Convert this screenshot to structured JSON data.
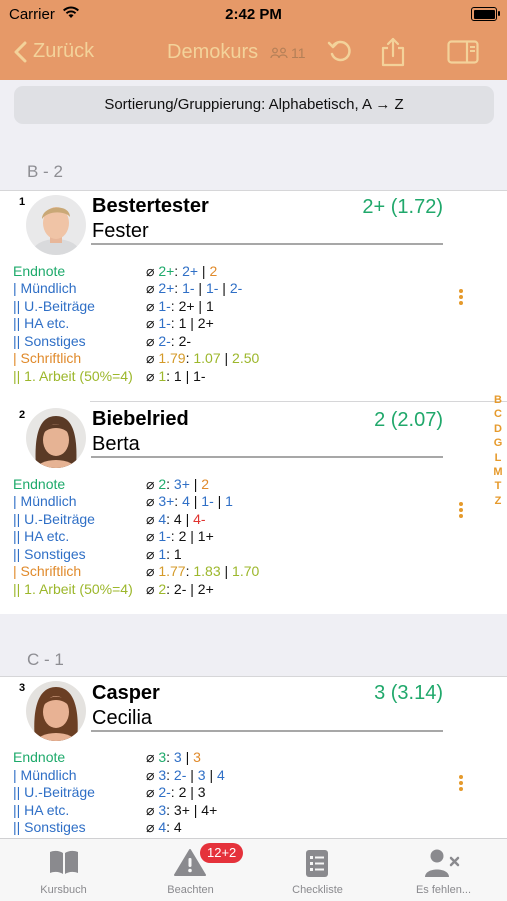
{
  "status": {
    "carrier": "Carrier",
    "time": "2:42 PM"
  },
  "nav": {
    "back_label": "Zurück",
    "title": "Demokurs",
    "student_count": "11"
  },
  "sort": {
    "label": "Sortierung/Gruppierung: Alphabetisch, A → Z"
  },
  "sections": [
    {
      "label": "B - 2"
    },
    {
      "label": "C - 1"
    }
  ],
  "students": [
    {
      "number": "1",
      "last_name": "Bestertester",
      "first_name": "Fester",
      "grade": "2+ (1.72)",
      "rows": {
        "endnote": {
          "label": "Endnote",
          "sym": "⌀",
          "avg": "2+",
          "sep": ":",
          "v1": "2+",
          "v2": "2"
        },
        "muendlich": {
          "label": "| Mündlich",
          "sym": "⌀",
          "avg": "2+",
          "sep": ":",
          "v1": "1-",
          "v2": "1-",
          "v3": "2-"
        },
        "beitraege": {
          "label": "|| U.-Beiträge",
          "sym": "⌀",
          "avg": "1-",
          "sep": ":",
          "v1": "2+",
          "v2": "1"
        },
        "ha": {
          "label": "|| HA etc.",
          "sym": "⌀",
          "avg": "1-",
          "sep": ":",
          "v1": "1",
          "v2": "2+"
        },
        "sonstiges": {
          "label": "|| Sonstiges",
          "sym": "⌀",
          "avg": "2-",
          "sep": ":",
          "v1": "2-"
        },
        "schriftlich": {
          "label": "| Schriftlich",
          "sym": "⌀",
          "avg": "1.79",
          "sep": ":",
          "v1": "1.07",
          "v2": "2.50"
        },
        "arbeit": {
          "label": "|| 1. Arbeit (50%=4)",
          "sym": "⌀",
          "avg": "1",
          "sep": ":",
          "v1": "1",
          "v2": "1-"
        }
      }
    },
    {
      "number": "2",
      "last_name": "Biebelried",
      "first_name": "Berta",
      "grade": "2 (2.07)",
      "rows": {
        "endnote": {
          "label": "Endnote",
          "sym": "⌀",
          "avg": "2",
          "sep": ":",
          "v1": "3+",
          "v2": "2"
        },
        "muendlich": {
          "label": "| Mündlich",
          "sym": "⌀",
          "avg": "3+",
          "sep": ":",
          "v1": "4",
          "v2": "1-",
          "v3": "1"
        },
        "beitraege": {
          "label": "|| U.-Beiträge",
          "sym": "⌀",
          "avg": "4",
          "sep": ":",
          "v1": "4",
          "v2": "4-"
        },
        "ha": {
          "label": "|| HA etc.",
          "sym": "⌀",
          "avg": "1-",
          "sep": ":",
          "v1": "2",
          "v2": "1+"
        },
        "sonstiges": {
          "label": "|| Sonstiges",
          "sym": "⌀",
          "avg": "1",
          "sep": ":",
          "v1": "1"
        },
        "schriftlich": {
          "label": "| Schriftlich",
          "sym": "⌀",
          "avg": "1.77",
          "sep": ":",
          "v1": "1.83",
          "v2": "1.70"
        },
        "arbeit": {
          "label": "|| 1. Arbeit (50%=4)",
          "sym": "⌀",
          "avg": "2",
          "sep": ":",
          "v1": "2-",
          "v2": "2+"
        }
      }
    },
    {
      "number": "3",
      "last_name": "Casper",
      "first_name": "Cecilia",
      "grade": "3 (3.14)",
      "rows": {
        "endnote": {
          "label": "Endnote",
          "sym": "⌀",
          "avg": "3",
          "sep": ":",
          "v1": "3",
          "v2": "3"
        },
        "muendlich": {
          "label": "| Mündlich",
          "sym": "⌀",
          "avg": "3",
          "sep": ":",
          "v1": "2-",
          "v2": "3",
          "v3": "4"
        },
        "beitraege": {
          "label": "|| U.-Beiträge",
          "sym": "⌀",
          "avg": "2-",
          "sep": ":",
          "v1": "2",
          "v2": "3"
        },
        "ha": {
          "label": "|| HA etc.",
          "sym": "⌀",
          "avg": "3",
          "sep": ":",
          "v1": "3+",
          "v2": "4+"
        },
        "sonstiges": {
          "label": "|| Sonstiges",
          "sym": "⌀",
          "avg": "4",
          "sep": ":",
          "v1": "4"
        }
      }
    }
  ],
  "alpha_index": [
    "B",
    "C",
    "D",
    "G",
    "L",
    "M",
    "T",
    "Z"
  ],
  "tabs": [
    {
      "label": "Kursbuch",
      "icon": "book-icon"
    },
    {
      "label": "Beachten",
      "icon": "warning-icon",
      "badge": "12+2"
    },
    {
      "label": "Checkliste",
      "icon": "checklist-icon"
    },
    {
      "label": "Es fehlen...",
      "icon": "person-x-icon"
    }
  ],
  "colors": {
    "nav_bg": "#e69968",
    "nav_text": "#f3d29a",
    "grade_green": "#20a86b",
    "accent_orange": "#e69a2c",
    "badge_red": "#e5323b"
  }
}
